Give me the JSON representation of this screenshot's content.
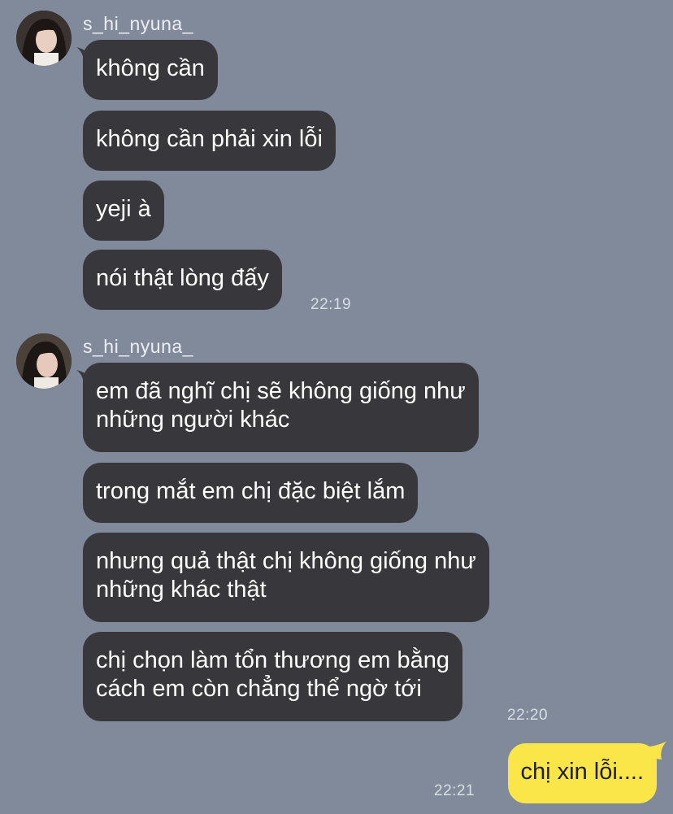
{
  "groups": [
    {
      "sender": "s_hi_nyuna_",
      "messages": [
        "không cần",
        "không cần phải xin lỗi",
        "yeji à",
        "nói thật lòng đấy"
      ],
      "time": "22:19"
    },
    {
      "sender": "s_hi_nyuna_",
      "messages": [
        "em đã nghĩ chị sẽ không giống như những người khác",
        "trong mắt em chị đặc biệt lắm",
        "nhưng quả thật chị không giống như những khác thật",
        "chị chọn làm tổn thương em bằng cách em còn chẳng thể ngờ tới"
      ],
      "lines": [
        [
          "em đã nghĩ chị sẽ không giống như",
          "những người khác"
        ],
        [
          "nhưng quả thật chị không giống như",
          "những khác thật"
        ],
        [
          "chị chọn làm tổn thương em bằng",
          "cách em còn chẳng thể ngờ tới"
        ]
      ],
      "time": "22:20"
    }
  ],
  "outgoing": {
    "message": "chị xin lỗi....",
    "time": "22:21"
  },
  "colors": {
    "background": "#808a9b",
    "incoming_bubble": "#38383c",
    "outgoing_bubble": "#fbe64a"
  }
}
